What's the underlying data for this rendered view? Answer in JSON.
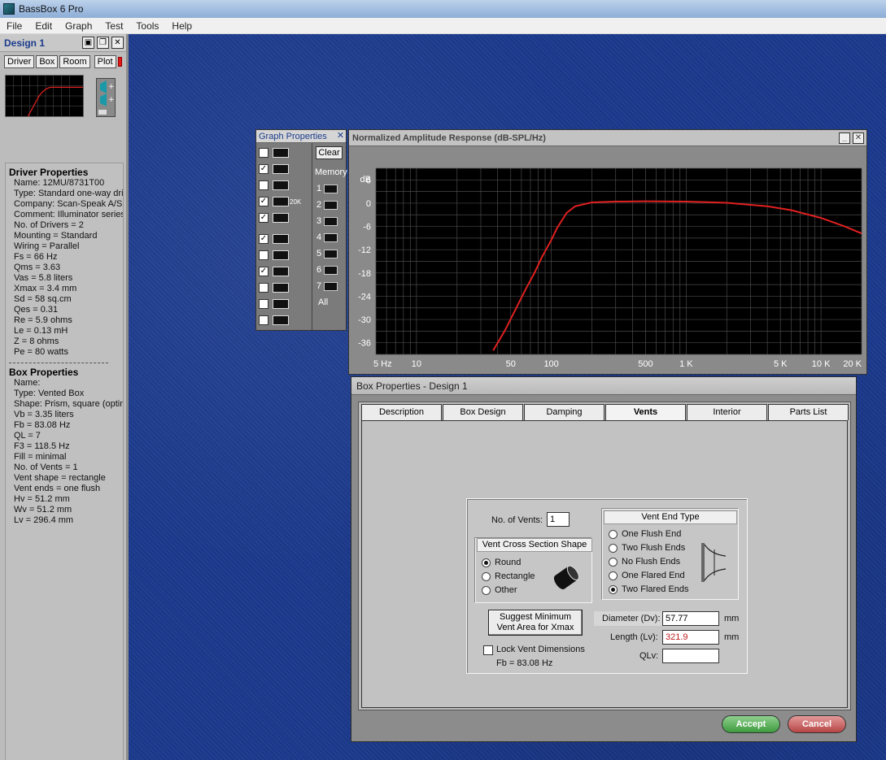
{
  "app": {
    "title": "BassBox 6 Pro"
  },
  "menu": [
    "File",
    "Edit",
    "Graph",
    "Test",
    "Tools",
    "Help"
  ],
  "design_panel": {
    "title": "Design 1",
    "tabs": [
      "Driver",
      "Box",
      "Room",
      "Plot"
    ],
    "driver_header": "Driver Properties",
    "driver_rows": [
      "Name: 12MU/8731T00",
      "Type: Standard one-way driv",
      "Company: Scan-Speak A/S",
      "Comment: Illuminator series",
      "No. of Drivers = 2",
      "Mounting = Standard",
      "Wiring = Parallel",
      "Fs = 66 Hz",
      "Qms = 3.63",
      "Vas = 5.8 liters",
      "Xmax = 3.4 mm",
      "Sd = 58 sq.cm",
      "Qes = 0.31",
      "Re = 5.9 ohms",
      "Le = 0.13 mH",
      "Z = 8 ohms",
      "Pe = 80 watts"
    ],
    "box_header": "Box Properties",
    "box_rows": [
      "Name:",
      "Type: Vented Box",
      "Shape: Prism, square (optimu",
      "Vb = 3.35 liters",
      "Fb = 83.08 Hz",
      "QL = 7",
      "F3 = 118.5 Hz",
      "Fill = minimal",
      "No. of Vents = 1",
      " Vent shape = rectangle",
      " Vent ends = one flush",
      " Hv = 51.2 mm",
      " Wv = 51.2 mm",
      " Lv = 296.4 mm"
    ]
  },
  "graph_props": {
    "title": "Graph Properties",
    "clear": "Clear",
    "memory": "Memory",
    "slots": [
      "1",
      "2",
      "3",
      "4",
      "5",
      "6",
      "7"
    ],
    "all": "All",
    "checks": [
      false,
      true,
      false,
      true,
      true,
      true,
      false,
      true,
      false,
      false,
      false
    ],
    "icon_20k": "20K"
  },
  "graph": {
    "title": "Normalized Amplitude Response (dB-SPL/Hz)",
    "ylabel": "dB",
    "yticks": [
      "6",
      "0",
      "-6",
      "-12",
      "-18",
      "-24",
      "-30",
      "-36"
    ],
    "xticks": [
      "5 Hz",
      "10",
      "50",
      "100",
      "500",
      "1 K",
      "5 K",
      "10 K",
      "20 K"
    ]
  },
  "chart_data": {
    "type": "line",
    "title": "Normalized Amplitude Response (dB-SPL/Hz)",
    "ylabel": "dB",
    "xscale": "log",
    "xlim": [
      5,
      20000
    ],
    "ylim": [
      -39,
      9
    ],
    "series": [
      {
        "x": [
          37,
          45,
          55,
          65,
          75,
          85,
          100,
          110,
          130,
          150,
          200,
          300,
          500,
          1000,
          2000,
          4000,
          6000,
          10000,
          15000,
          20000
        ],
        "y": [
          -38,
          -33,
          -27,
          -22,
          -18,
          -14,
          -9.5,
          -6.5,
          -2.5,
          -0.8,
          0.2,
          0.4,
          0.5,
          0.4,
          0.1,
          -0.8,
          -1.8,
          -3.8,
          -6,
          -7.8
        ],
        "color": "#e02020"
      }
    ]
  },
  "box_dialog": {
    "title": "Box Properties - Design 1",
    "tabs": [
      "Description",
      "Box Design",
      "Damping",
      "Vents",
      "Interior",
      "Parts List"
    ],
    "active_tab": "Vents",
    "no_vents_label": "No. of Vents:",
    "no_vents_value": "1",
    "shape_header": "Vent Cross Section Shape",
    "shape_options": [
      "Round",
      "Rectangle",
      "Other"
    ],
    "shape_selected": "Round",
    "end_header": "Vent End Type",
    "end_options": [
      "One Flush End",
      "Two Flush Ends",
      "No Flush Ends",
      "One Flared End",
      "Two Flared Ends"
    ],
    "end_selected": "Two Flared Ends",
    "suggest_line1": "Suggest Minimum",
    "suggest_line2": "Vent Area for Xmax",
    "lock_label": "Lock Vent Dimensions",
    "fb_text": "Fb = 83.08 Hz",
    "diameter_label": "Diameter (Dv):",
    "diameter_value": "57.77",
    "length_label": "Length (Lv):",
    "length_value": "321.9",
    "qlv_label": "QLv:",
    "qlv_value": "",
    "unit": "mm",
    "accept": "Accept",
    "cancel": "Cancel"
  }
}
